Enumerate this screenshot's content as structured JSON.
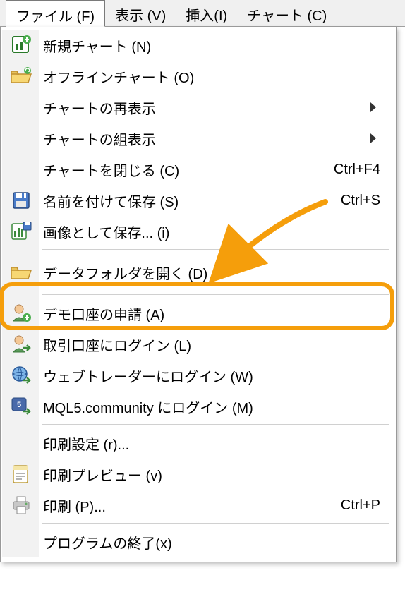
{
  "menubar": {
    "file": "ファイル (F)",
    "view": "表示 (V)",
    "insert": "挿入(I)",
    "chart": "チャート (C)"
  },
  "menu": {
    "new_chart": "新規チャート (N)",
    "offline_chart": "オフラインチャート (O)",
    "chart_redisplay": "チャートの再表示",
    "chart_group_display": "チャートの組表示",
    "chart_close": "チャートを閉じる (C)",
    "chart_close_key": "Ctrl+F4",
    "save_as": "名前を付けて保存 (S)",
    "save_as_key": "Ctrl+S",
    "save_image": "画像として保存... (i)",
    "open_data_folder": "データフォルダを開く (D)",
    "demo_account": "デモ口座の申請 (A)",
    "login_trade": "取引口座にログイン (L)",
    "login_webtrader": "ウェブトレーダーにログイン (W)",
    "login_mql5": "MQL5.community にログイン (M)",
    "print_setup": "印刷設定 (r)...",
    "print_preview": "印刷プレビュー (v)",
    "print": "印刷 (P)...",
    "print_key": "Ctrl+P",
    "exit": "プログラムの終了(x)"
  }
}
